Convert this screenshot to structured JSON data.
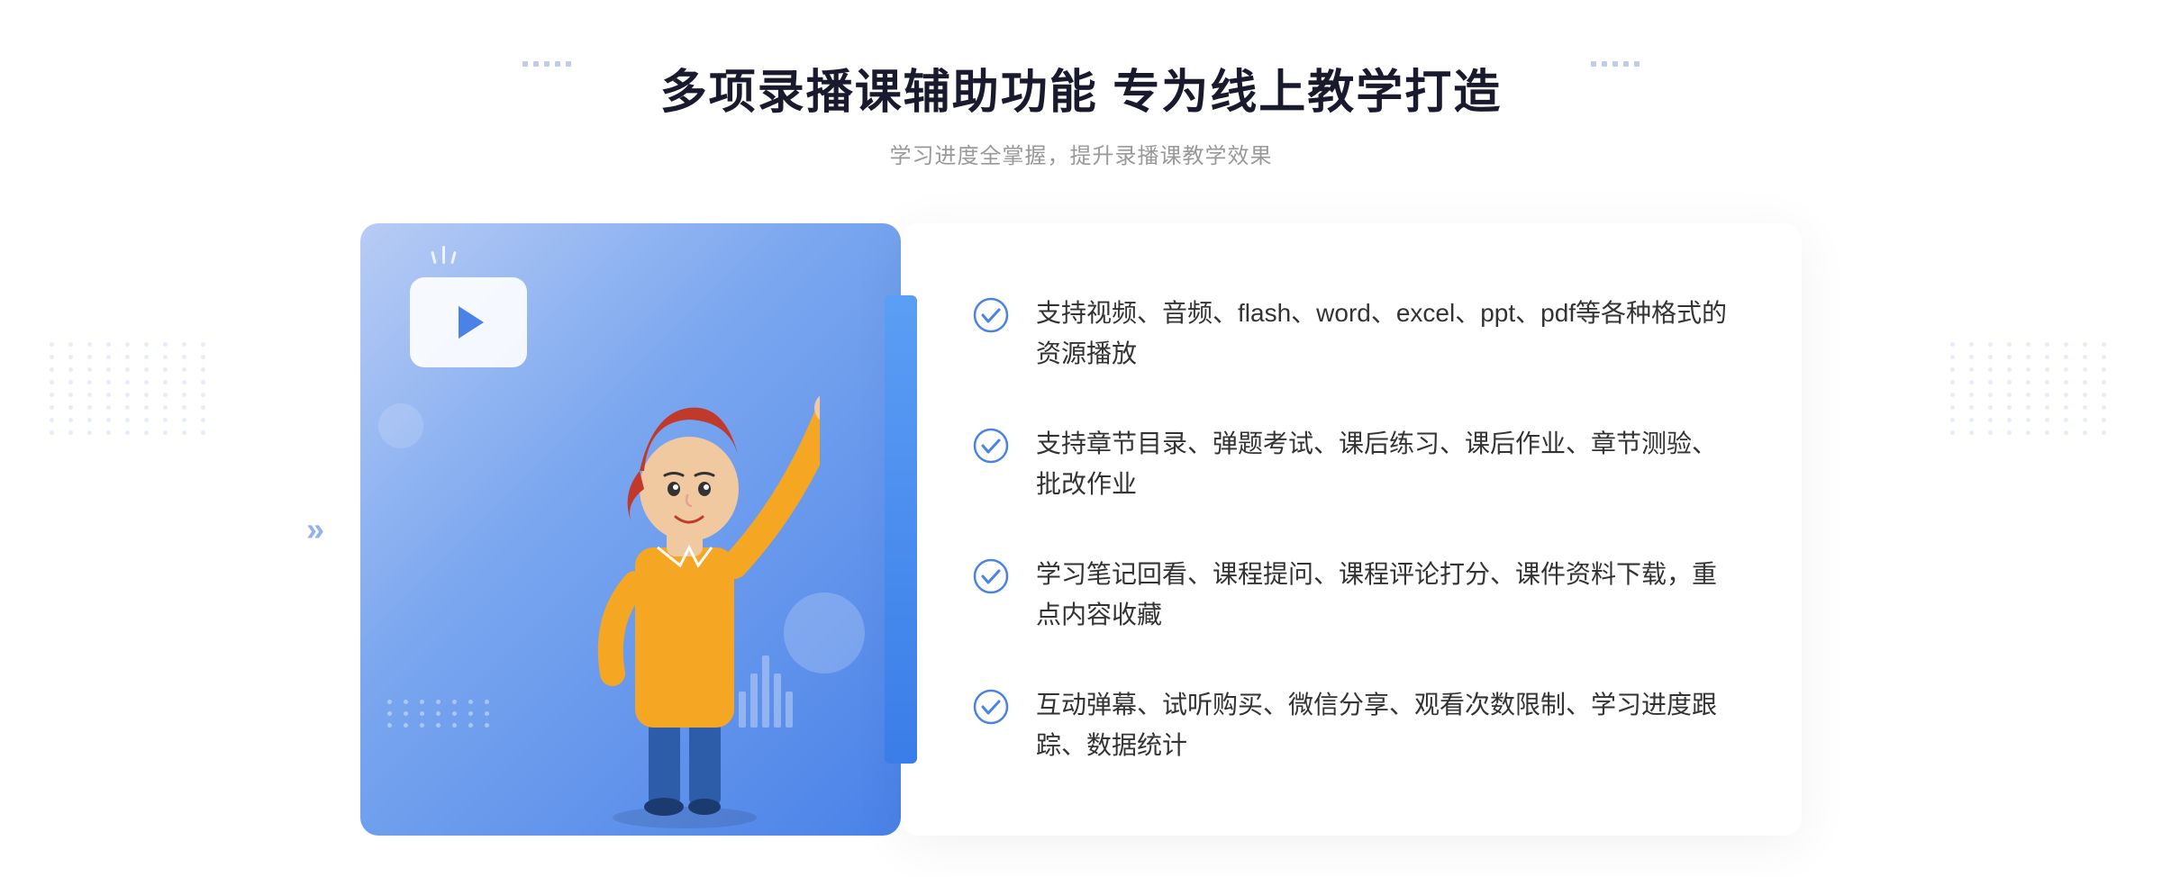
{
  "header": {
    "title": "多项录播课辅助功能 专为线上教学打造",
    "subtitle": "学习进度全掌握，提升录播课教学效果"
  },
  "features": [
    {
      "id": "feature-1",
      "text": "支持视频、音频、flash、word、excel、ppt、pdf等各种格式的资源播放"
    },
    {
      "id": "feature-2",
      "text": "支持章节目录、弹题考试、课后练习、课后作业、章节测验、批改作业"
    },
    {
      "id": "feature-3",
      "text": "学习笔记回看、课程提问、课程评论打分、课件资料下载，重点内容收藏"
    },
    {
      "id": "feature-4",
      "text": "互动弹幕、试听购买、微信分享、观看次数限制、学习进度跟踪、数据统计"
    }
  ],
  "colors": {
    "primary_blue": "#4a82e8",
    "light_blue": "#7ba7ef",
    "bg_gradient_start": "#b8ccf5",
    "text_dark": "#1a1a2e",
    "text_gray": "#999999",
    "text_body": "#333333"
  },
  "icons": {
    "check": "check-circle",
    "play": "play-triangle",
    "chevron": "double-chevron-right"
  }
}
